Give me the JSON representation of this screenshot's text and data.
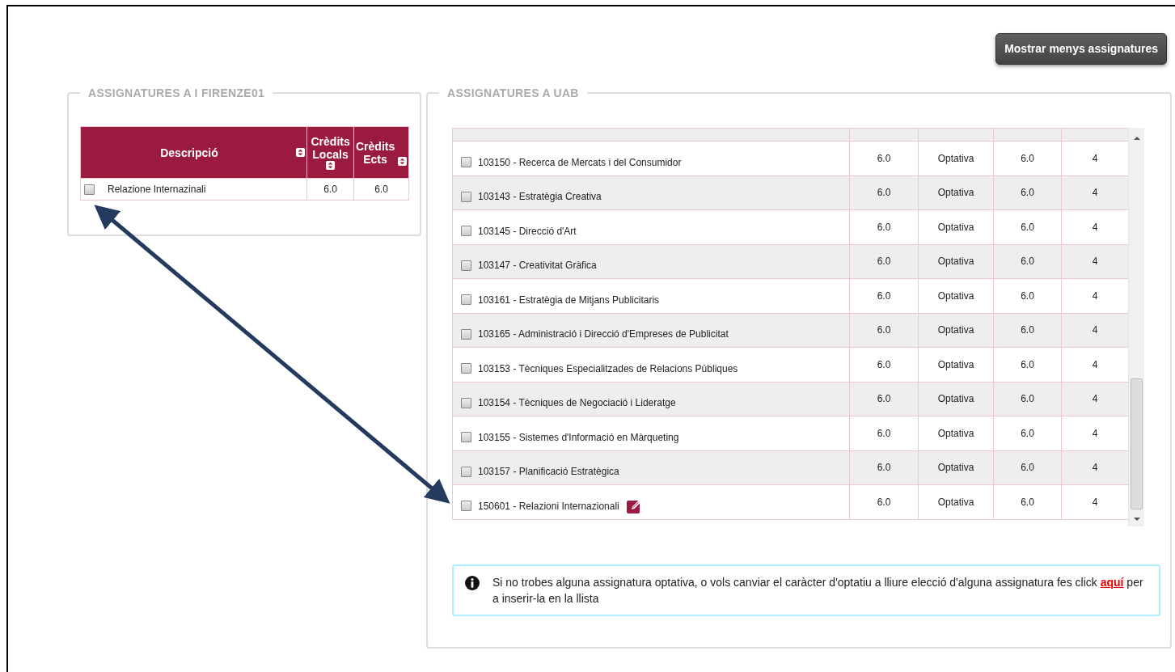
{
  "toggle_button": "Mostrar menys assignatures",
  "local_panel": {
    "legend": "ASSIGNATURES A I FIRENZE01",
    "columns": [
      {
        "label": "Descripció"
      },
      {
        "label": "Crèdits Locals"
      },
      {
        "label": "Crèdits Ects"
      }
    ],
    "rows": [
      {
        "checked": false,
        "description": "Relazione Internazinali",
        "credits_local": "6.0",
        "credits_ects": "6.0"
      }
    ]
  },
  "uab_panel": {
    "legend": "ASSIGNATURES A UAB",
    "rows": [
      {
        "checked": false,
        "description": "103150 - Recerca de Mercats i del Consumidor",
        "edit_icon": false,
        "column_2": "6.0",
        "column_3": "Optativa",
        "column_4": "6.0",
        "column_5": "4"
      },
      {
        "checked": false,
        "description": "103143 - Estratègia Creativa",
        "edit_icon": false,
        "column_2": "6.0",
        "column_3": "Optativa",
        "column_4": "6.0",
        "column_5": "4"
      },
      {
        "checked": false,
        "description": "103145 - Direcció d'Art",
        "edit_icon": false,
        "column_2": "6.0",
        "column_3": "Optativa",
        "column_4": "6.0",
        "column_5": "4"
      },
      {
        "checked": false,
        "description": "103147 - Creativitat Gràfica",
        "edit_icon": false,
        "column_2": "6.0",
        "column_3": "Optativa",
        "column_4": "6.0",
        "column_5": "4"
      },
      {
        "checked": false,
        "description": "103161 - Estratègia de Mitjans Publicitaris",
        "edit_icon": false,
        "column_2": "6.0",
        "column_3": "Optativa",
        "column_4": "6.0",
        "column_5": "4"
      },
      {
        "checked": false,
        "description": "103165 - Administració i Direcció d'Empreses de Publicitat",
        "edit_icon": false,
        "column_2": "6.0",
        "column_3": "Optativa",
        "column_4": "6.0",
        "column_5": "4"
      },
      {
        "checked": false,
        "description": "103153 - Tècniques Especialitzades de Relacions Públiques",
        "edit_icon": false,
        "column_2": "6.0",
        "column_3": "Optativa",
        "column_4": "6.0",
        "column_5": "4"
      },
      {
        "checked": false,
        "description": "103154 - Tècniques de Negociació i Lideratge",
        "edit_icon": false,
        "column_2": "6.0",
        "column_3": "Optativa",
        "column_4": "6.0",
        "column_5": "4"
      },
      {
        "checked": false,
        "description": "103155 - Sistemes d'Informació en Màrqueting",
        "edit_icon": false,
        "column_2": "6.0",
        "column_3": "Optativa",
        "column_4": "6.0",
        "column_5": "4"
      },
      {
        "checked": false,
        "description": "103157 - Planificació Estratègica",
        "edit_icon": false,
        "column_2": "6.0",
        "column_3": "Optativa",
        "column_4": "6.0",
        "column_5": "4"
      },
      {
        "checked": false,
        "description": "150601 - Relazioni Internazionali",
        "edit_icon": true,
        "column_2": "6.0",
        "column_3": "Optativa",
        "column_4": "6.0",
        "column_5": "4"
      }
    ],
    "info": {
      "text_before": "Si no trobes alguna assignatura optativa, o vols canviar el caràcter d'optatiu a lliure elecció d'alguna assignatura fes click",
      "link": "aquí",
      "text_after": "per a inserir-la en la llista"
    }
  }
}
